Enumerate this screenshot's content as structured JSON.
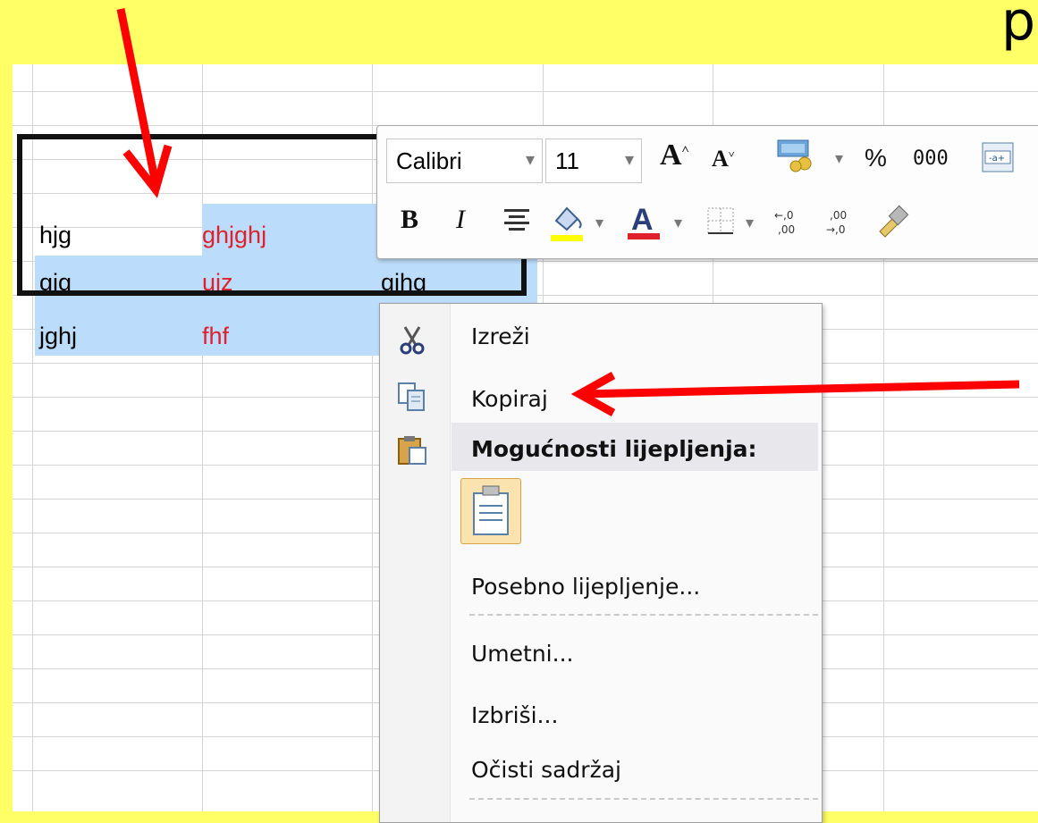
{
  "banner": {
    "partial_glyph": "p"
  },
  "cells": [
    {
      "row": 0,
      "col": "A",
      "text": "hjg",
      "color": "#000000"
    },
    {
      "row": 0,
      "col": "B",
      "text": "ghjghj",
      "color": "#e0202a"
    },
    {
      "row": 1,
      "col": "A",
      "text": "gjg",
      "color": "#000000"
    },
    {
      "row": 1,
      "col": "B",
      "text": "ujz",
      "color": "#e0202a"
    },
    {
      "row": 1,
      "col": "C",
      "text": "gjhg",
      "color": "#000000"
    },
    {
      "row": 2,
      "col": "A",
      "text": "jghj",
      "color": "#000000"
    },
    {
      "row": 2,
      "col": "B",
      "text": "fhf",
      "color": "#e0202a"
    }
  ],
  "mini_toolbar": {
    "font_name": "Calibri",
    "font_size": "11",
    "percent_label": "%",
    "thousands_label": "000",
    "bold_label": "B",
    "italic_label": "I",
    "font_color_label": "A",
    "fill_color": "#ffff00",
    "font_color": "#e0202a"
  },
  "context_menu": {
    "cut": "Izreži",
    "copy": "Kopiraj",
    "paste_options_header": "Mogućnosti lijepljenja:",
    "paste_special": "Posebno lijepljenje...",
    "insert": "Umetni...",
    "delete": "Izbriši...",
    "clear_contents": "Očisti sadržaj"
  },
  "annotation_color": "#ff0000"
}
